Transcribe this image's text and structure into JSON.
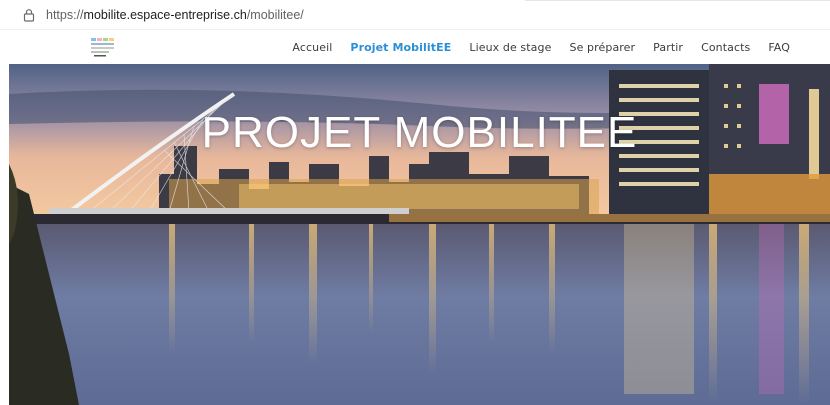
{
  "browser": {
    "url_scheme": "https://",
    "url_host": "mobilite.espace-entreprise.ch",
    "url_path": "/mobilitee/",
    "lock_icon": "lock-icon"
  },
  "header": {
    "logo_icon": "site-logo-icon",
    "nav": [
      {
        "label": "Accueil",
        "active": false
      },
      {
        "label": "Projet MobilitEE",
        "active": true
      },
      {
        "label": "Lieux de stage",
        "active": false
      },
      {
        "label": "Se préparer",
        "active": false
      },
      {
        "label": "Partir",
        "active": false
      },
      {
        "label": "Contacts",
        "active": false
      },
      {
        "label": "FAQ",
        "active": false
      }
    ],
    "accent_color": "#2a8fd6"
  },
  "hero": {
    "title": "PROJET MOBILITEE",
    "image_description_icon": "city-river-night-image"
  }
}
